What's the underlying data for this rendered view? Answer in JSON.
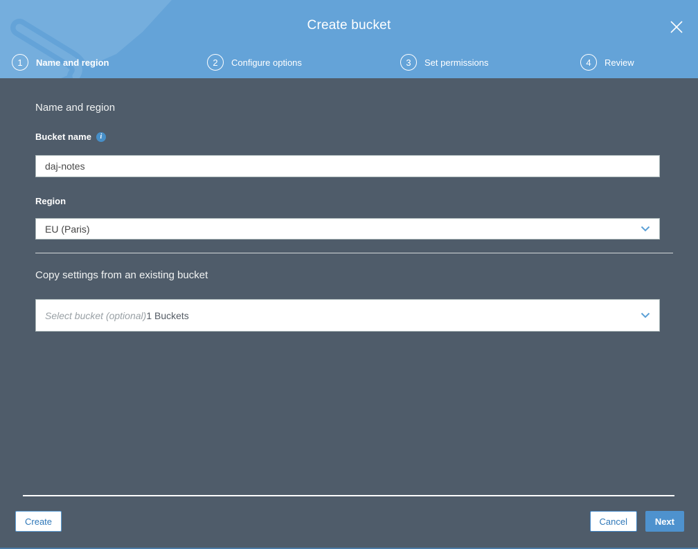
{
  "modal": {
    "title": "Create bucket"
  },
  "steps": [
    {
      "number": "1",
      "label": "Name and region",
      "active": true
    },
    {
      "number": "2",
      "label": "Configure options",
      "active": false
    },
    {
      "number": "3",
      "label": "Set permissions",
      "active": false
    },
    {
      "number": "4",
      "label": "Review",
      "active": false
    }
  ],
  "form": {
    "section_heading": "Name and region",
    "bucket_name": {
      "label": "Bucket name",
      "value": "daj-notes"
    },
    "region": {
      "label": "Region",
      "selected_option": "EU (Paris)"
    },
    "copy_settings": {
      "heading": "Copy settings from an existing bucket",
      "placeholder": "Select bucket (optional)",
      "suffix": "1 Buckets"
    }
  },
  "footer": {
    "create_label": "Create",
    "cancel_label": "Cancel",
    "next_label": "Next"
  },
  "icons": {
    "info_glyph": "i"
  },
  "colors": {
    "header_blue": "#64a3d8",
    "watermark_blue": "#75aedd",
    "body_slate": "#4f5c6a",
    "accent_blue": "#4e92ce",
    "link_blue": "#2e77b8",
    "info_blue": "#478fc8"
  }
}
